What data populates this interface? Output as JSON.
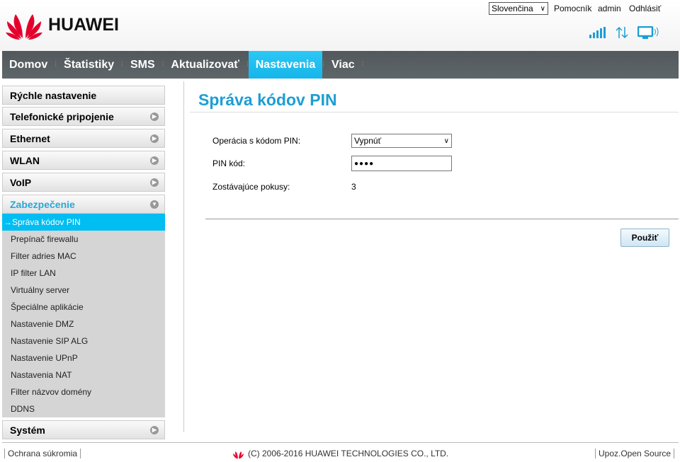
{
  "header": {
    "brand": "HUAWEI",
    "language": "Slovenčina",
    "links": [
      "Pomocník",
      "admin",
      "Odhlásiť"
    ],
    "status_icons": [
      "signal-icon",
      "data-transfer-icon",
      "pc-connection-icon"
    ]
  },
  "nav": {
    "items": [
      "Domov",
      "Štatistiky",
      "SMS",
      "Aktualizovať",
      "Nastavenia",
      "Viac"
    ],
    "active": "Nastavenia"
  },
  "sidebar": {
    "groups": [
      "Rýchle nastavenie",
      "Telefonické pripojenie",
      "Ethernet",
      "WLAN",
      "VoIP",
      "Zabezpečenie"
    ],
    "submenu": [
      "Správa kódov PIN",
      "Prepínač firewallu",
      "Filter adries MAC",
      "IP filter LAN",
      "Virtuálny server",
      "Špeciálne aplikácie",
      "Nastavenie DMZ",
      "Nastavenie SIP ALG",
      "Nastavenie UPnP",
      "Nastavenia NAT",
      "Filter názvov domény",
      "DDNS"
    ],
    "last": "Systém",
    "active_sub_arrow": "→"
  },
  "main": {
    "title": "Správa kódov PIN",
    "pin_operation_label": "Operácia s kódom PIN:",
    "pin_operation_value": "Vypnúť",
    "pin_code_label": "PIN kód:",
    "pin_code_value": "●●●●",
    "attempts_label": "Zostávajúce pokusy:",
    "attempts_value": "3",
    "apply": "Použiť"
  },
  "footer": {
    "privacy": "Ochrana súkromia",
    "copyright": "(C) 2006-2016 HUAWEI TECHNOLOGIES CO., LTD.",
    "open_source": "Upoz.Open Source"
  },
  "colors": {
    "accent": "#00bdf2",
    "title": "#1d9ed3",
    "nav": "#585e61",
    "brand_red": "#e4002b"
  }
}
